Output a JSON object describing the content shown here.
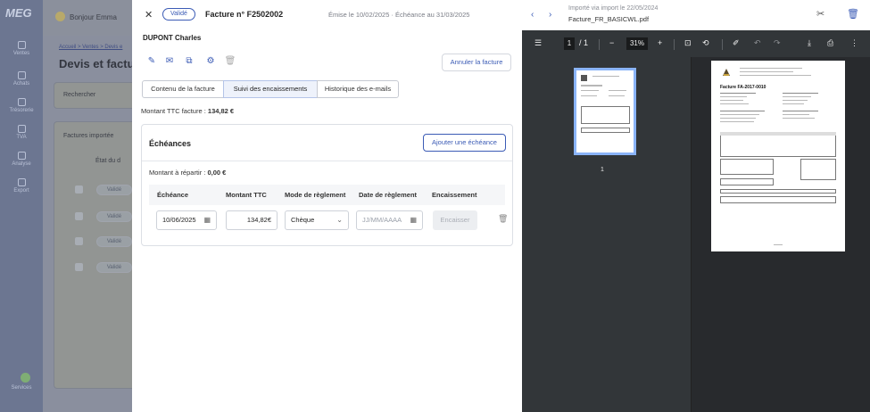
{
  "background": {
    "logo": "MEG",
    "greeting": "Bonjour Emma",
    "breadcrumb": "Accueil > Ventes > Devis e",
    "page_title": "Devis et factu",
    "search_placeholder": "Rechercher",
    "tab_label": "Factures importée",
    "column_label": "État du d",
    "row_status": "Validé",
    "sidebar": [
      {
        "label": "Ventes",
        "icon": "shop-icon"
      },
      {
        "label": "Achats",
        "icon": "bag-icon"
      },
      {
        "label": "Trésorerie",
        "icon": "bank-icon"
      },
      {
        "label": "TVA",
        "icon": "calculator-icon"
      },
      {
        "label": "Analyse",
        "icon": "chart-icon"
      },
      {
        "label": "Export",
        "icon": "upload-icon"
      },
      {
        "label": "Services",
        "icon": "rocket-icon"
      }
    ]
  },
  "invoice": {
    "status": "Validé",
    "number": "Facture n° F2502002",
    "issued": "Émise le 10/02/2025 · Échéance au 31/03/2025",
    "client": "DUPONT Charles",
    "cancel_label": "Annuler la facture",
    "tabs": [
      {
        "label": "Contenu de la facture",
        "active": false
      },
      {
        "label": "Suivi des encaissements",
        "active": true
      },
      {
        "label": "Historique des e-mails",
        "active": false
      }
    ],
    "total_label": "Montant TTC facture :",
    "total_value": "134,82 €",
    "schedule": {
      "title": "Échéances",
      "add_label": "Ajouter une échéance",
      "remaining_label": "Montant à répartir :",
      "remaining_value": "0,00 €",
      "columns": [
        "Échéance",
        "Montant TTC",
        "Mode de règlement",
        "Date de règlement",
        "Encaissement"
      ],
      "rows": [
        {
          "due_date": "10/06/2025",
          "amount": "134,82€",
          "payment_mode": "Chèque",
          "payment_date_placeholder": "JJ/MM/AAAA",
          "action": "Encaisser"
        }
      ]
    }
  },
  "viewer": {
    "import_note": "Importé via import le 22/05/2024",
    "file_name": "Facture_FR_BASICWL.pdf",
    "page_current": "1",
    "page_total": "/ 1",
    "zoom": "31%",
    "thumb_label": "1",
    "doc_title": "Facture FA-2017-0010"
  }
}
